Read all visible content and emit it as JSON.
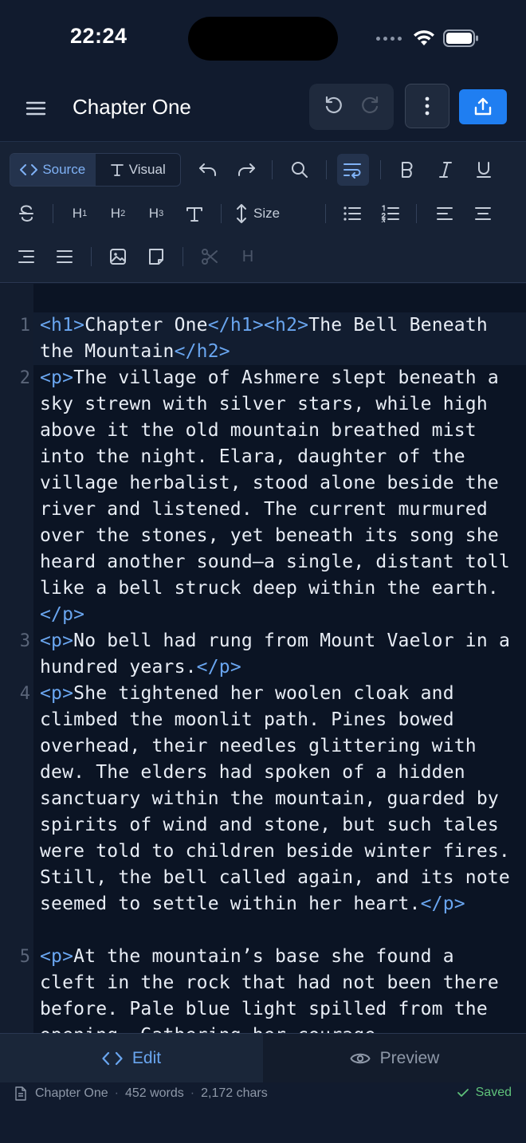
{
  "status": {
    "time": "22:24"
  },
  "header": {
    "title": "Chapter One"
  },
  "toolbar": {
    "source_label": "Source",
    "visual_label": "Visual",
    "h1_main": "H",
    "h1_sub": "1",
    "h2_main": "H",
    "h2_sub": "2",
    "h3_main": "H",
    "h3_sub": "3",
    "size_label": "Size",
    "hr_label": "H"
  },
  "editor": {
    "lines": [
      {
        "no": "1",
        "html": "<span class=\"tag\">&lt;h1&gt;</span>Chapter One<span class=\"tag\">&lt;/h1&gt;&lt;h2&gt;</span>The Bell Beneath the Mountain<span class=\"tag\">&lt;/h2&gt;</span>"
      },
      {
        "no": "2",
        "html": "<span class=\"tag\">&lt;p&gt;</span>The village of Ashmere slept beneath a sky strewn with silver stars, while high above it the old mountain breathed mist into the night. Elara, daughter of the village herbalist, stood alone beside the river and listened. The current murmured over the stones, yet beneath its song she heard another sound—a single, distant toll like a bell struck deep within the earth.<span class=\"tag\">&lt;/p&gt;</span>"
      },
      {
        "no": "3",
        "html": "<span class=\"tag\">&lt;p&gt;</span>No bell had rung from Mount Vaelor in a hundred years.<span class=\"tag\">&lt;/p&gt;</span>"
      },
      {
        "no": "4",
        "html": "<span class=\"tag\">&lt;p&gt;</span>She tightened her woolen cloak and climbed the moonlit path. Pines bowed overhead, their needles glittering with dew. The elders had spoken of a hidden sanctuary within the mountain, guarded by spirits of wind and stone, but such tales were told to children beside winter fires. Still, the bell called again, and its note seemed to settle within her heart.<span class=\"tag\">&lt;/p&gt;</span>"
      },
      {
        "no": "5",
        "html": "<span class=\"tag\">&lt;p&gt;</span>At the mountain’s base she found a cleft in the rock that had not been there before. Pale blue light spilled from the opening. Gathering her courage"
      }
    ]
  },
  "tabs": {
    "edit": "Edit",
    "preview": "Preview"
  },
  "footer": {
    "doc_name": "Chapter One",
    "words": "452 words",
    "chars": "2,172 chars",
    "saved": "Saved"
  },
  "colors": {
    "accent": "#1f7ef1",
    "tag": "#6aa6f0",
    "saved": "#5fc27a"
  }
}
